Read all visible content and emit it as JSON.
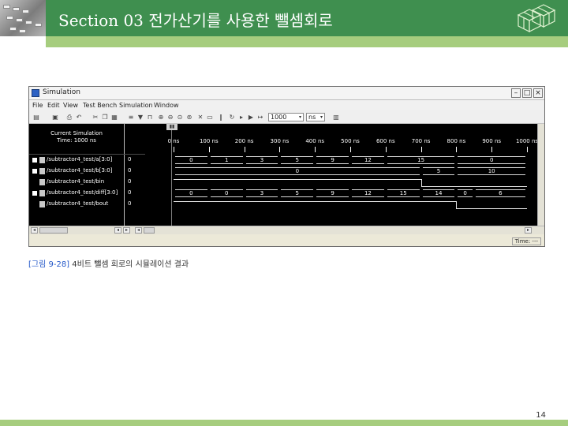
{
  "slide": {
    "title": "Section 03 전가산기를 사용한 뺄셈회로",
    "caption_figure": "[그림 9-28]",
    "caption_text": "4비트 뺄셈 회로의 시뮬레이션 결과",
    "page_number": "14",
    "colors": {
      "header": "#3f8f4f",
      "accent_band": "#a6cd7e",
      "figure_label": "#2357c8"
    },
    "logo_icon": "cube-stack-icon"
  },
  "window": {
    "title": "Simulation",
    "menu": [
      "File",
      "Edit",
      "View",
      "Test Bench",
      "Simulation",
      "Window"
    ],
    "step_value": "1000",
    "step_unit": "ns",
    "status": "Time: ---"
  },
  "panel": {
    "heading_line1": "Current Simulation",
    "heading_line2": "Time: 1000 ns",
    "signals": [
      {
        "name": "/subtractor4_test/a[3:0]",
        "value": "0"
      },
      {
        "name": "/subtractor4_test/b[3:0]",
        "value": "0"
      },
      {
        "name": "/subtractor4_test/bin",
        "value": "0"
      },
      {
        "name": "/subtractor4_test/diff[3:0]",
        "value": "0"
      },
      {
        "name": "/subtractor4_test/bout",
        "value": "0"
      }
    ]
  },
  "timeline": {
    "unit": "ns",
    "start": 0,
    "end": 1000,
    "ticks": [
      {
        "t": 0,
        "label": "0 ns"
      },
      {
        "t": 100,
        "label": "100 ns"
      },
      {
        "t": 200,
        "label": "200 ns"
      },
      {
        "t": 300,
        "label": "300 ns"
      },
      {
        "t": 400,
        "label": "400 ns"
      },
      {
        "t": 500,
        "label": "500 ns"
      },
      {
        "t": 600,
        "label": "600 ns"
      },
      {
        "t": 700,
        "label": "700 ns"
      },
      {
        "t": 800,
        "label": "800 ns"
      },
      {
        "t": 900,
        "label": "900 ns"
      },
      {
        "t": 1000,
        "label": "1000 ns"
      }
    ],
    "buses": [
      {
        "segments": [
          {
            "start": 0,
            "end": 100,
            "label": "0"
          },
          {
            "start": 100,
            "end": 200,
            "label": "1"
          },
          {
            "start": 200,
            "end": 300,
            "label": "3"
          },
          {
            "start": 300,
            "end": 400,
            "label": "5"
          },
          {
            "start": 400,
            "end": 500,
            "label": "9"
          },
          {
            "start": 500,
            "end": 600,
            "label": "12"
          },
          {
            "start": 600,
            "end": 800,
            "label": "15"
          },
          {
            "start": 800,
            "end": 1000,
            "label": "0"
          }
        ]
      },
      {
        "segments": [
          {
            "start": 0,
            "end": 700,
            "label": "0"
          },
          {
            "start": 700,
            "end": 800,
            "label": "5"
          },
          {
            "start": 800,
            "end": 1000,
            "label": "10"
          }
        ]
      },
      {
        "segments": []
      },
      {
        "segments": [
          {
            "start": 0,
            "end": 100,
            "label": "0"
          },
          {
            "start": 100,
            "end": 200,
            "label": "0"
          },
          {
            "start": 200,
            "end": 300,
            "label": "3"
          },
          {
            "start": 300,
            "end": 400,
            "label": "5"
          },
          {
            "start": 400,
            "end": 500,
            "label": "9"
          },
          {
            "start": 500,
            "end": 600,
            "label": "12"
          },
          {
            "start": 600,
            "end": 700,
            "label": "15"
          },
          {
            "start": 700,
            "end": 800,
            "label": "14"
          },
          {
            "start": 800,
            "end": 850,
            "label": "0"
          },
          {
            "start": 850,
            "end": 1000,
            "label": "6"
          }
        ]
      },
      {
        "segments": []
      }
    ],
    "wires": {
      "bin": [
        {
          "start": 0,
          "end": 700,
          "value": 1
        },
        {
          "start": 700,
          "end": 1000,
          "value": 0
        }
      ],
      "bout": [
        {
          "start": 0,
          "end": 800,
          "value": 1
        },
        {
          "start": 800,
          "end": 1000,
          "value": 0
        }
      ]
    }
  }
}
